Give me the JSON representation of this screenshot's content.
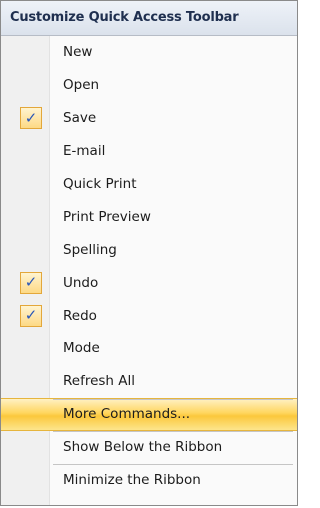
{
  "menu": {
    "title": "Customize Quick Access Toolbar",
    "check_icon": "checkmark-icon",
    "accent_color": "#ffd65e",
    "items": [
      {
        "label": "New",
        "checked": false
      },
      {
        "label": "Open",
        "checked": false
      },
      {
        "label": "Save",
        "checked": true
      },
      {
        "label": "E-mail",
        "checked": false
      },
      {
        "label": "Quick Print",
        "checked": false
      },
      {
        "label": "Print Preview",
        "checked": false
      },
      {
        "label": "Spelling",
        "checked": false
      },
      {
        "label": "Undo",
        "checked": true
      },
      {
        "label": "Redo",
        "checked": true
      },
      {
        "label": "Mode",
        "checked": false
      },
      {
        "label": "Refresh All",
        "checked": false
      },
      {
        "label": "More Commands...",
        "checked": false,
        "highlighted": true
      },
      {
        "label": "Show Below the Ribbon",
        "checked": false
      },
      {
        "label": "Minimize the Ribbon",
        "checked": false
      }
    ]
  }
}
